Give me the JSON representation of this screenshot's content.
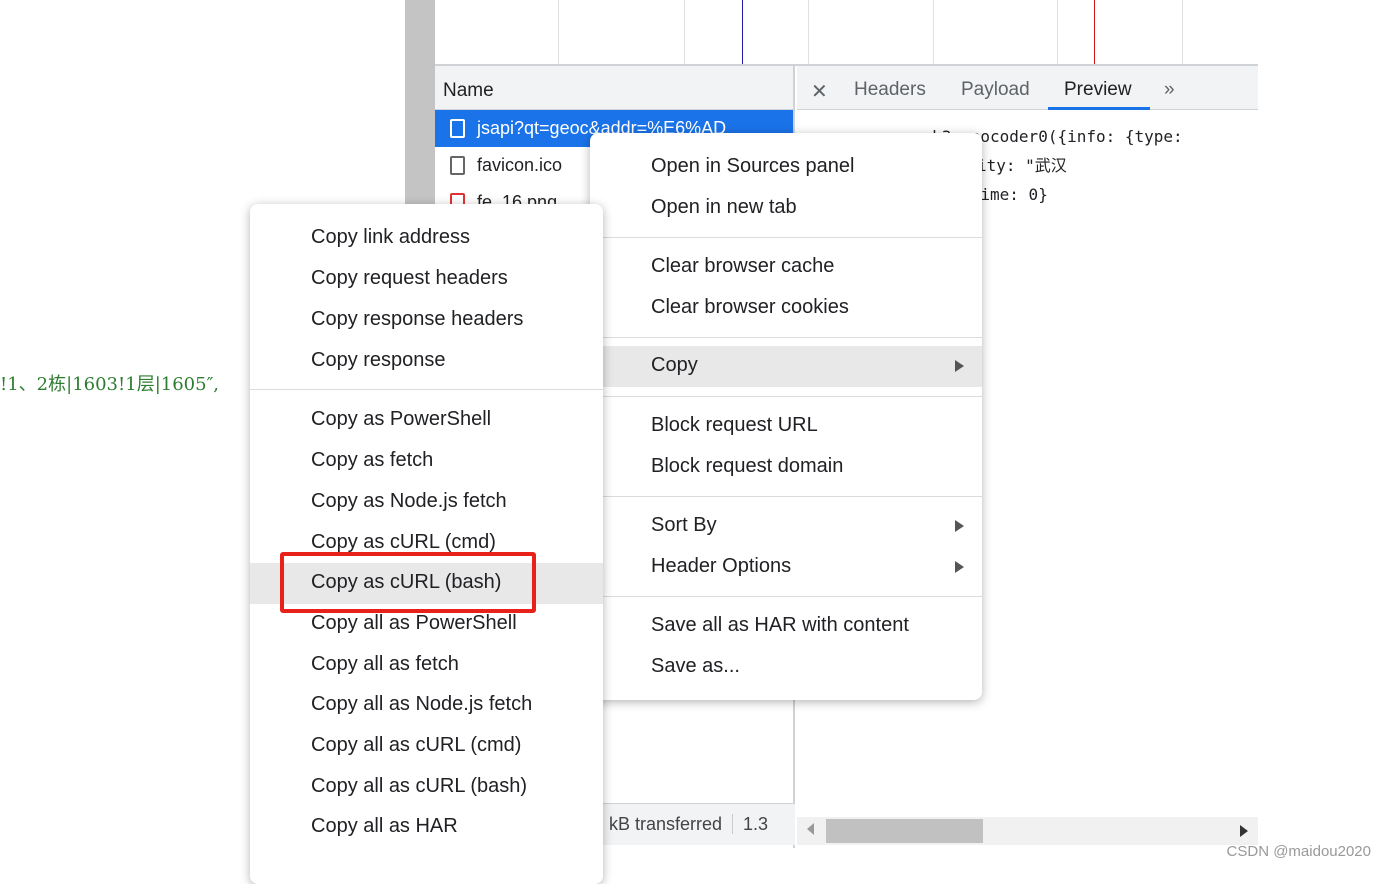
{
  "background_code": "!1、2栋|1603!1层|1605″,",
  "network": {
    "name_header": "Name",
    "rows": [
      {
        "name": "jsapi?qt=geoc&addr=%E6%AD",
        "selected": true
      },
      {
        "name": "favicon.ico"
      },
      {
        "name": "fe_16.png"
      }
    ],
    "status": "kB transferred",
    "status2": "1.3"
  },
  "details": {
    "tabs": [
      "Headers",
      "Payload",
      "Preview"
    ],
    "active_tab": "Preview",
    "more_icon": "double-chevron-icon",
    "preview_lines": [
      "▼qq.maps._svcb3.geocoder0({info: {type:",
      "    ...e: \"鑫成大厦\", city: \"武汉",
      "    ...45, error: 0, time: 0}"
    ]
  },
  "context_menu": {
    "items": [
      "Open in Sources panel",
      "Open in new tab",
      "Clear browser cache",
      "Clear browser cookies",
      "Copy",
      "Block request URL",
      "Block request domain",
      "Sort By",
      "Header Options",
      "Save all as HAR with content",
      "Save as..."
    ],
    "highlighted": "Copy"
  },
  "copy_submenu": {
    "items": [
      "Copy link address",
      "Copy request headers",
      "Copy response headers",
      "Copy response",
      "Copy as PowerShell",
      "Copy as fetch",
      "Copy as Node.js fetch",
      "Copy as cURL (cmd)",
      "Copy as cURL (bash)",
      "Copy all as PowerShell",
      "Copy all as fetch",
      "Copy all as Node.js fetch",
      "Copy all as cURL (cmd)",
      "Copy all as cURL (bash)",
      "Copy all as HAR"
    ],
    "highlighted": "Copy as cURL (bash)",
    "annotation_color": "#e8221b"
  },
  "watermark": "CSDN @maidou2020"
}
